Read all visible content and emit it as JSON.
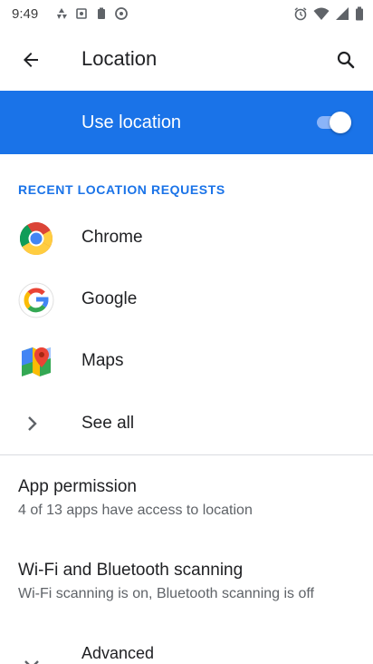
{
  "status_bar": {
    "time": "9:49",
    "left_icons": [
      "photos-icon",
      "game-icon",
      "battery-saver-icon",
      "data-saver-icon"
    ],
    "right_icons": [
      "alarm-icon",
      "wifi-icon",
      "signal-icon",
      "battery-icon"
    ]
  },
  "app_bar": {
    "title": "Location"
  },
  "master_switch": {
    "label": "Use location",
    "checked": true
  },
  "recent_requests": {
    "header": "RECENT LOCATION REQUESTS",
    "apps": [
      {
        "label": "Chrome",
        "icon": "chrome-icon"
      },
      {
        "label": "Google",
        "icon": "google-icon"
      },
      {
        "label": "Maps",
        "icon": "maps-icon"
      }
    ],
    "see_all": "See all"
  },
  "preferences": [
    {
      "title": "App permission",
      "summary": "4 of 13 apps have access to location"
    },
    {
      "title": "Wi-Fi and Bluetooth scanning",
      "summary": "Wi-Fi scanning is on, Bluetooth scanning is off"
    }
  ],
  "advanced": {
    "label": "Advanced"
  },
  "colors": {
    "accent": "#1a73e8",
    "toggle_track": "#8ab4f8",
    "divider": "#dadce0"
  }
}
